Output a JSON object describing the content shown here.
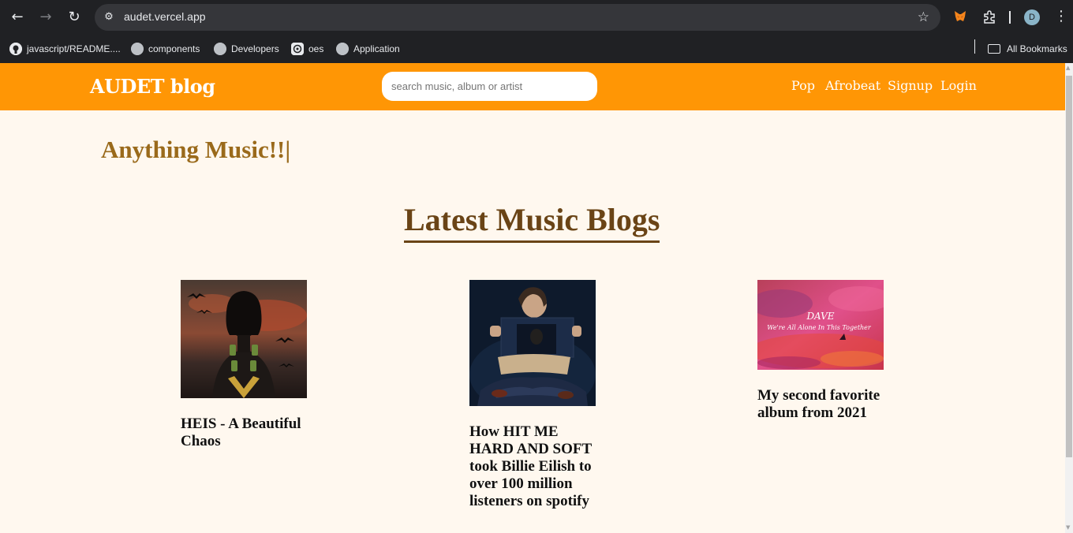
{
  "browser": {
    "back_icon": "←",
    "forward_icon": "→",
    "reload_icon": "↻",
    "site_info_icon": "⚙",
    "url": "audet.vercel.app",
    "star_icon": "☆",
    "metamask_icon": "🦊",
    "extensions_icon": "⧉",
    "profile_initial": "D",
    "menu_icon": "⋮"
  },
  "bookmarks": [
    {
      "label": "javascript/README....",
      "icon": "github-icon"
    },
    {
      "label": "components",
      "icon": "globe-icon"
    },
    {
      "label": "Developers",
      "icon": "globe-icon"
    },
    {
      "label": "oes",
      "icon": "openai-icon"
    },
    {
      "label": "Application",
      "icon": "globe-icon"
    }
  ],
  "all_bookmarks_label": "All Bookmarks",
  "site": {
    "logo": "AUDET blog",
    "search_placeholder": "search music, album or artist",
    "nav": [
      "Pop",
      "Afrobeat",
      "Signup",
      "Login"
    ],
    "brand_color": "#ff9605"
  },
  "hero_text": "Anything Music!!|",
  "section_title": "Latest Music Blogs",
  "blogs": [
    {
      "title": "HEIS - A Beautiful Chaos",
      "image": "album-art-heis"
    },
    {
      "title": "How HIT ME HARD AND SOFT took Billie Eilish to over 100 million listeners on spotify",
      "image": "billie-eilish-photo"
    },
    {
      "title": "My second favorite album from 2021",
      "image": "dave-album-art"
    }
  ],
  "album_art_text": {
    "artist": "DAVE",
    "album": "We're All Alone In This Together"
  }
}
